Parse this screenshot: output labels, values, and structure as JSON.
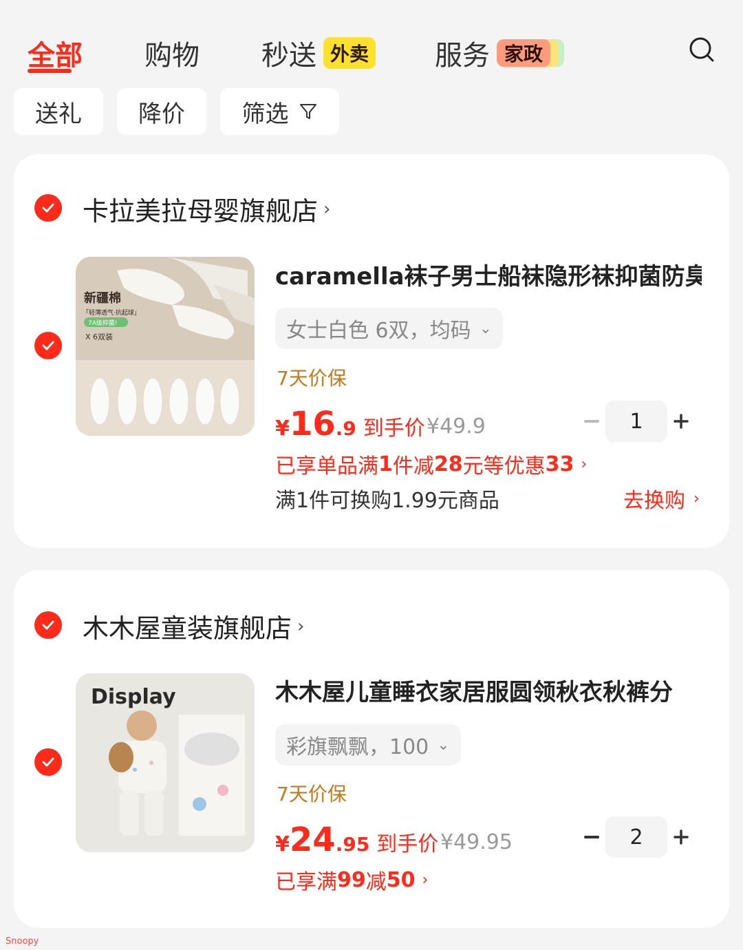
{
  "tabs": {
    "all": "全部",
    "shopping": "购物",
    "express": "秒送",
    "express_tag": "外卖",
    "service": "服务",
    "service_tag": "家政"
  },
  "filters": {
    "gift": "送礼",
    "price_drop": "降价",
    "filter": "筛选"
  },
  "stores": [
    {
      "name": "卡拉美拉母婴旗舰店",
      "item": {
        "title": "caramella袜子男士船袜隐形袜抑菌防臭",
        "spec": "女士白色 6双，均码",
        "guarantee": "7天价保",
        "price_symbol": "¥",
        "price_int": "16",
        "price_dec": ".9",
        "price_label": "到手价",
        "orig_price": "¥49.9",
        "quantity": "1",
        "promo_prefix": "已享单品满",
        "promo_bold1": "1",
        "promo_mid1": "件减",
        "promo_bold2": "28",
        "promo_mid2": "元等优惠",
        "promo_bold3": "33",
        "exchange_text": "满1件可换购1.99元商品",
        "exchange_link": "去换购",
        "thumb_title": "新疆棉",
        "thumb_sub": "「轻薄透气·抗起球」",
        "thumb_badge": "7A级抑菌!",
        "thumb_count": "X 6双装"
      }
    },
    {
      "name": "木木屋童装旗舰店",
      "item": {
        "title": "木木屋儿童睡衣家居服圆领秋衣秋裤分",
        "spec": "彩旗飘飘，100",
        "guarantee": "7天价保",
        "price_symbol": "¥",
        "price_int": "24",
        "price_dec": ".95",
        "price_label": "到手价",
        "orig_price": "¥49.95",
        "quantity": "2",
        "promo_prefix": "已享满",
        "promo_bold1": "99",
        "promo_mid1": "减",
        "promo_bold2": "50",
        "thumb_title": "Display"
      }
    }
  ],
  "watermark": "Snoopy",
  "colors": {
    "accent": "#ff2a1a",
    "guarantee": "#c27a1a",
    "tag_yellow": "#ffe02e",
    "tag_salmon": "#ff9b7d"
  },
  "icons": {
    "search": "search-icon",
    "filter": "funnel-icon",
    "check": "check-circle-icon",
    "chevron": "chevron-right-icon"
  }
}
